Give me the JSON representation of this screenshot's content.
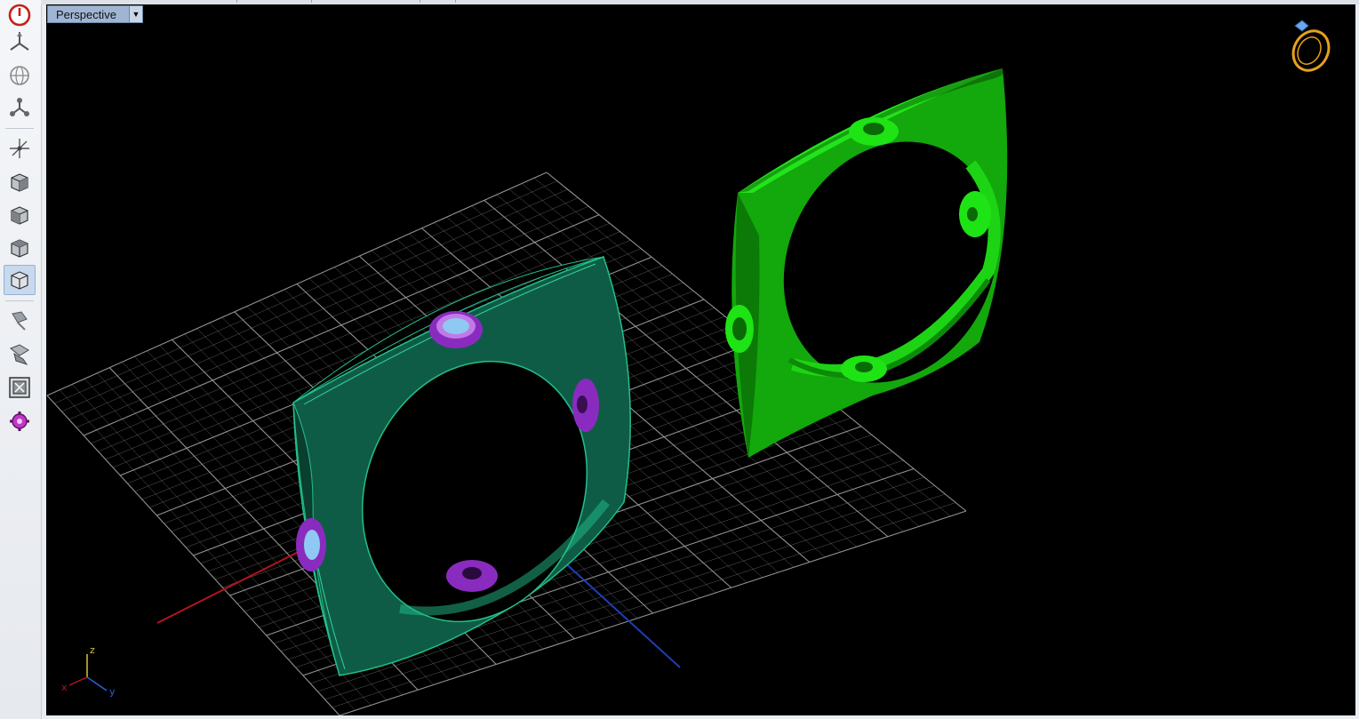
{
  "viewport": {
    "view_name": "Perspective",
    "dropdown_icon": "chevron-down-icon",
    "axis_triad": {
      "x_label": "x",
      "y_label": "y",
      "z_label": "z"
    }
  },
  "toolbar": {
    "items": [
      {
        "name": "power-icon"
      },
      {
        "name": "pan-icon"
      },
      {
        "name": "globe-icon"
      },
      {
        "name": "nodes-icon"
      },
      {
        "name": "move-axes-icon"
      },
      {
        "name": "view-cube-front-icon"
      },
      {
        "name": "view-cube-side-icon"
      },
      {
        "name": "view-cube-top-icon"
      },
      {
        "name": "view-cube-iso-icon",
        "active": true
      },
      {
        "name": "render-light-icon"
      },
      {
        "name": "camera-icon"
      },
      {
        "name": "zoom-extents-icon"
      },
      {
        "name": "settings-gear-icon"
      }
    ]
  },
  "colors": {
    "viewport_bg": "#000000",
    "grid": "#9a9a9a",
    "ring_teal": "#0f5c46",
    "ring_green": "#19d011",
    "setting_purple": "#8a2bbf",
    "gem_blue": "#8fc8f2",
    "axis_x": "#b3141c",
    "axis_y": "#1f3fb8",
    "ring_logo": "#e7a11c"
  }
}
